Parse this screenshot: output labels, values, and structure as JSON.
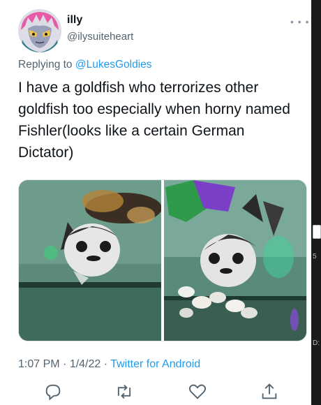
{
  "author": {
    "name": "illy",
    "handle": "@ilysuiteheart",
    "avatar_icon": "anime-avatar-icon"
  },
  "reply": {
    "prefix": "Replying to ",
    "mention": "@LukesGoldies"
  },
  "tweet": {
    "text": "I have a goldfish who terrorizes other goldfish too especially when horny named Fishler(looks like a certain German Dictator)"
  },
  "media": {
    "images": [
      {
        "name": "goldfish-photo-left"
      },
      {
        "name": "goldfish-photo-right"
      }
    ]
  },
  "meta": {
    "time": "1:07 PM",
    "sep1": " · ",
    "date": "1/4/22",
    "sep2": " · ",
    "source": "Twitter for Android"
  },
  "actions": [
    {
      "name": "reply-icon"
    },
    {
      "name": "retweet-icon"
    },
    {
      "name": "like-icon"
    },
    {
      "name": "share-icon"
    }
  ],
  "colors": {
    "accent": "#1d9bf0",
    "secondary_text": "#536471",
    "text": "#0f1419"
  },
  "edge": {
    "letter_5": "5",
    "letter_d": "D:"
  }
}
